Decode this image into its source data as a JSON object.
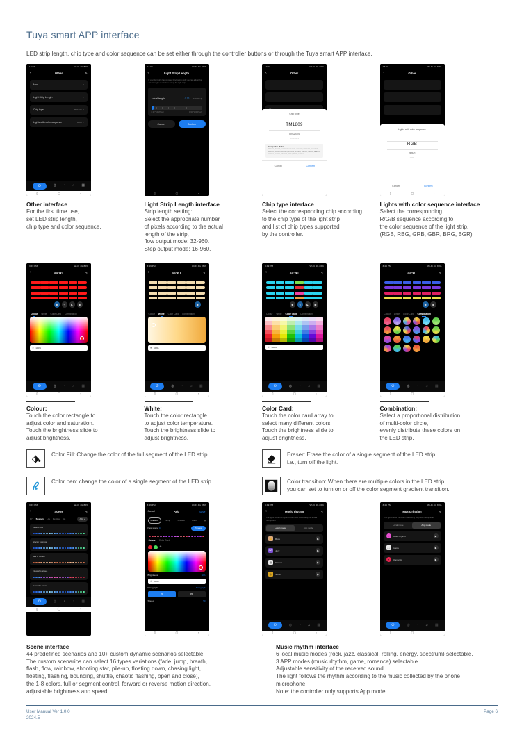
{
  "header": {
    "title": "Tuya smart APP interface",
    "intro": "LED strip length, chip type and color sequence can be set either through the controller buttons or through the Tuya smart APP interface."
  },
  "phones": {
    "other": {
      "status_left": "13:04",
      "status_right": "Wi-Fi 4G 89%",
      "nav_title": "Other",
      "back_icon": "chevron-left-icon",
      "edit_icon": "edit-icon",
      "rows": [
        {
          "label": "Mac",
          "value": ""
        },
        {
          "label": "Light Strip Length",
          "value": ""
        },
        {
          "label": "Chip type",
          "value": "TM1809"
        },
        {
          "label": "Lights with color sequence",
          "value": "RGB"
        }
      ]
    },
    "strip_length": {
      "status_left": "13:04",
      "status_right": "Wi-Fi 4G 89%",
      "nav_title": "Light Strip Length",
      "hint": "If your light strip has stopped functioning well, you can adjust the actual length on it before set up the light strip.",
      "card_label": "Actual length",
      "card_value": "0.32",
      "card_unit": "*100(Pixel)",
      "range_min": "0.32 *100(Pixel)",
      "range_max": "9.60 *100(Pixel)",
      "cancel": "Cancel",
      "confirm": "Confirm"
    },
    "chip_type": {
      "status_left": "13:04",
      "status_right": "Wi-Fi 4G 89%",
      "nav_title": "Other",
      "row_label": "Chip type",
      "row_value": "TM1809",
      "sheet_title": "Chip type",
      "selected": "TM1809",
      "next": "TM1829",
      "far": "UCS1903",
      "compat_title": "Compatible Model",
      "compat_body": "TM1804, TM1812, UCS1903, UCS1909, UCS1912, SM16703, SM16703P, WS2811, WS2812, WS2813, WS2815, WS2818, GS8206, GS8208, APA102, SK6812, SK9822, LPD6803, P9813, P9883, DMX512",
      "cancel": "Cancel",
      "confirm": "Confirm"
    },
    "color_sequence": {
      "status_left": "13:04",
      "status_right": "Wi-Fi 4G 89%",
      "nav_title": "Other",
      "sheet_title": "Lights with color sequence",
      "selected": "RGB",
      "next": "RBG",
      "far": "GRB",
      "cancel": "Cancel",
      "confirm": "Confirm"
    },
    "colour": {
      "status_left": "3:49 PM",
      "status_right": "Wi-Fi 4G 86%",
      "nav_title": "SS-WT",
      "tabs": [
        "Colour",
        "White",
        "Color Card",
        "Combination"
      ],
      "selected_tab": "Colour",
      "brightness": "100%",
      "strip_color": "#ff1a1a"
    },
    "white": {
      "status_left": "3:49 PM",
      "status_right": "Wi-Fi 4G 86%",
      "nav_title": "SS-WT",
      "tabs": [
        "Colour",
        "White",
        "Color Card",
        "Combination"
      ],
      "selected_tab": "White",
      "brightness": "100%",
      "strip_color": "#f3dcb0"
    },
    "color_card": {
      "status_left": "3:49 PM",
      "status_right": "Wi-Fi 4G 86%",
      "nav_title": "SS-WT",
      "tabs": [
        "Colour",
        "White",
        "Color Card",
        "Combination"
      ],
      "selected_tab": "Color Card",
      "brightness": "100%",
      "strip_color": "#2ad4ef"
    },
    "combination": {
      "status_left": "3:49 PM",
      "status_right": "Wi-Fi 4G 86%",
      "nav_title": "SS-WT",
      "tabs": [
        "Colour",
        "White",
        "Color Card",
        "Combination"
      ],
      "selected_tab": "Combination"
    },
    "scene": {
      "status_left": "3:49 PM",
      "status_right": "Wi-Fi 4G 86%",
      "nav_title": "Scene",
      "tabs": [
        "DIY",
        "Scenery",
        "Life",
        "Festival",
        "Mo"
      ],
      "selected_tab": "Scenery",
      "add_label": "Add +",
      "items": [
        "Ireland blue",
        "Glacier express",
        "Sea of clouds",
        "Fireworks at sea",
        "Hut in the snow"
      ]
    },
    "add_scene": {
      "status_left": "3:49 PM",
      "status_right": "Wi-Fi 4G 86%",
      "cancel": "Cancel",
      "nav_title": "Add",
      "save": "Save",
      "chips": [
        "Gradient",
        "Jump",
        "Breathe",
        "Flash"
      ],
      "selected_chip": "Gradient",
      "name_label": "New scene",
      "name_value": "C",
      "preview_btn": "Preview",
      "tabs": [
        "Colour",
        "Color Card"
      ],
      "selected_tab": "Colour",
      "brightness_label": "Brightness",
      "brightness_value": "60%",
      "brightness_bar": "100%",
      "paragraph_label": "Paragraph",
      "paragraph_value": "Paragraph",
      "speed_label": "Speed",
      "speed_value": "50"
    },
    "music_local": {
      "status_left": "3:49 PM",
      "status_right": "Wi-Fi 4G 86%",
      "nav_title": "Music rhythm",
      "hint": "The lights follow the rhythm of the music collected by the device microphone.",
      "mode_tabs": [
        "Local mode",
        "App mode"
      ],
      "selected_mode": "Local mode",
      "items": [
        {
          "name": "Rock",
          "color": "#d9a87e"
        },
        {
          "name": "Jazz",
          "color": "#7b4fd4"
        },
        {
          "name": "Classic",
          "color": "#e8e8e8"
        },
        {
          "name": "Scroll",
          "color": "#d9a41f"
        }
      ]
    },
    "music_app": {
      "status_left": "3:49 PM",
      "status_right": "Wi-Fi 4G 86%",
      "nav_title": "Music rhythm",
      "hint": "The lights follow the music collected by the phone microphone.",
      "mode_tabs": [
        "Local mode",
        "App mode"
      ],
      "selected_mode": "App mode",
      "items": [
        {
          "name": "Music rhythm",
          "color": "#e84fd0"
        },
        {
          "name": "Game",
          "color": "#e8e8e8"
        },
        {
          "name": "Romantic",
          "color": "#e8234f"
        }
      ]
    }
  },
  "captions": {
    "other": {
      "title": "Other interface",
      "body": "For the first time use,\nset LED strip length,\nchip type and color sequence."
    },
    "strip_length": {
      "title": "Light Strip Length interface",
      "body": "Strip length setting:\nSelect the appropriate number\nof pixels according to the actual\nlength of the strip,\nflow output mode: 32-960.\nStep output mode: 16-960."
    },
    "chip_type": {
      "title": "Chip type interface",
      "body": "Select the corresponding chip according\nto the chip type of the light strip\nand list of chip types supported\nby the controller."
    },
    "color_sequence": {
      "title": "Lights with color sequence interface",
      "body": "Select the corresponding\nR/G/B sequence according to\nthe color sequence of the light strip.\n(RGB, RBG, GRB, GBR, BRG, BGR)"
    },
    "colour": {
      "title": "Colour:",
      "body": "Touch the color rectangle to\nadjust color and saturation.\nTouch the brightness slide to\nadjust brightness."
    },
    "white": {
      "title": "White:",
      "body": "Touch the color rectangle\nto adjust color temperature.\nTouch the brightness slide to\nadjust brightness."
    },
    "color_card": {
      "title": "Color Card:",
      "body": "Touch the color card array to\nselect many different colors.\nTouch the brightness slide to\nadjust brightness."
    },
    "combination": {
      "title": "Combination:",
      "body": "Select a proportional distribution\nof multi-color circle,\nevenly distribute these colors on\nthe LED strip."
    },
    "scene": {
      "title": "Scene interface",
      "body": "44 predefined scenarios and 10+ custom dynamic scenarios selectable.\nThe custom scenarios can select 16 types variations (fade, jump, breath,\nflash, flow, rainbow, shooting star, pile-up, floating down, chasing light,\nfloating, flashing, bouncing, shuttle, chaotic flashing, open and close),\nthe 1-8 colors, full or segment control, forward or reverse motion direction,\nadjustable brightness and speed."
    },
    "music": {
      "title": "Music rhythm interface",
      "body": "6 local music modes (rock, jazz, classical, rolling, energy, spectrum) selectable.\n3 APP modes (music rhythm, game, romance) selectable.\nAdjustable sensitivity of the received sound.\nThe light follows the rhythm according to the music collected by the phone\nmicrophone.\nNote: the controller only supports App mode."
    }
  },
  "legend": [
    {
      "icon": "paint-bucket-icon",
      "text": "Color Fill: Change the color of the full segment of the LED strip."
    },
    {
      "icon": "eraser-icon",
      "text": "Eraser: Erase the color of a single segment of the LED strip,\ni.e., turn off the light."
    },
    {
      "icon": "color-pen-icon",
      "text": "Color pen: change the color of a single segment of the LED strip."
    },
    {
      "icon": "color-transition-icon",
      "text": "Color transition: When there are multiple colors in the LED strip,\nyou can set to turn on or off the color segment gradient transition."
    }
  ],
  "footer": {
    "left": "User Manual Ver 1.0.0\n2024.5",
    "right": "Page 6"
  },
  "colors": {
    "accent": "#4a6b8a",
    "primary": "#1d7df0"
  }
}
